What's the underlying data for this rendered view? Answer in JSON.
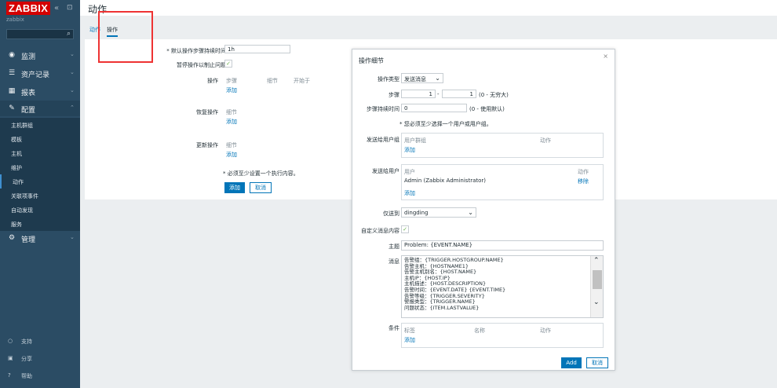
{
  "app": {
    "logo": "ZABBIX",
    "subtitle": "zabbix",
    "collapse_icon": "«",
    "kiosk_icon": "⊡"
  },
  "sidebar": {
    "menu": [
      {
        "label": "监测",
        "icon": "eye-icon"
      },
      {
        "label": "资产记录",
        "icon": "list-icon"
      },
      {
        "label": "报表",
        "icon": "chart-icon"
      },
      {
        "label": "配置",
        "icon": "wrench-icon"
      },
      {
        "label": "管理",
        "icon": "gear-icon"
      }
    ],
    "config_sub": [
      "主机群组",
      "模板",
      "主机",
      "维护",
      "动作",
      "关联项事件",
      "自动发现",
      "服务"
    ],
    "footer": [
      {
        "label": "支持",
        "icon": "help-icon"
      },
      {
        "label": "分享",
        "icon": "share-icon"
      },
      {
        "label": "帮助",
        "icon": "question-icon"
      }
    ]
  },
  "header": {
    "title": "动作"
  },
  "tabs": [
    "动作",
    "操作"
  ],
  "form": {
    "default_step_label": "* 默认操作步骤持续时间",
    "default_step_value": "1h",
    "pause_label": "暂停操作以制止问题",
    "ops_label": "操作",
    "ops_cols": [
      "步骤",
      "细节",
      "开始于"
    ],
    "add": "添加",
    "recovery_label": "恢复操作",
    "update_label": "更新操作",
    "detail_col": "细节",
    "must_set": "* 必须至少设置一个执行内容。",
    "add_button": "添加",
    "cancel_button": "取消"
  },
  "modal": {
    "title": "操作细节",
    "close": "×",
    "op_type_label": "操作类型",
    "op_type_value": "发送消息",
    "steps_label": "步骤",
    "step_from": "1",
    "step_to": "1",
    "step_hint": "(0 - 无穷大)",
    "step_duration_label": "步骤持续时间",
    "step_duration_value": "0",
    "step_duration_hint": "(0 - 使用默认)",
    "warn": "* 您必须至少选择一个用户或用户组。",
    "send_group_label": "发送给用户组",
    "group_col": "用户群组",
    "action_col": "动作",
    "add": "添加",
    "send_user_label": "发送给用户",
    "user_col": "用户",
    "user_action_col": "动作",
    "user_name": "Admin (Zabbix Administrator)",
    "remove": "移除",
    "only_send_label": "仅送到",
    "only_send_value": "dingding",
    "custom_msg_label": "自定义消息内容",
    "subject_label": "主题",
    "subject_value": "Problem: {EVENT.NAME}",
    "message_label": "消息",
    "message_lines": [
      "告警组：{TRIGGER.HOSTGROUP.NAME}",
      "告警主机：{HOSTNAME1}",
      "告警主机别名：{HOST.NAME}",
      "主机IP：{HOST.IP}",
      "主机描述：{HOST.DESCRIPTION}",
      "告警时间：{EVENT.DATE} {EVENT.TIME}",
      "告警等级：{TRIGGER.SEVERITY}",
      "警报类型：{TRIGGER.NAME}",
      "问题状态：{ITEM.LASTVALUE}"
    ],
    "cond_label": "条件",
    "cond_cols": [
      "标签",
      "名称",
      "动作"
    ],
    "add_btn": "Add",
    "cancel_btn": "取消"
  }
}
